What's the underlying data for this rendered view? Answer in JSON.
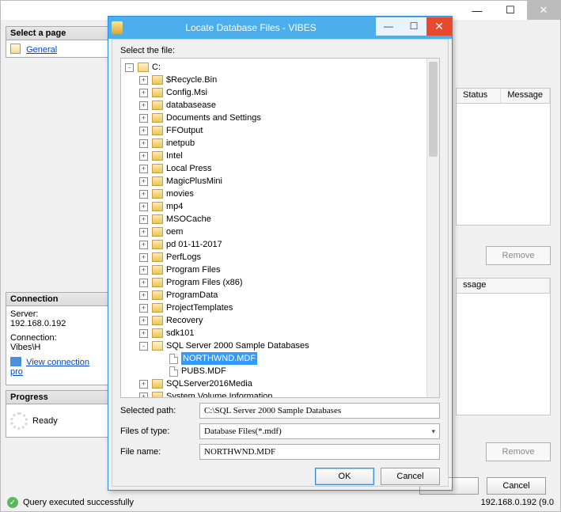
{
  "bg": {
    "select_page": "Select a page",
    "general": "General",
    "connection_h": "Connection",
    "server_lbl": "Server:",
    "server_val": "192.168.0.192",
    "conn_lbl": "Connection:",
    "conn_val": "Vibes\\H",
    "view_conn": "View connection pro",
    "progress_h": "Progress",
    "progress_state": "Ready",
    "col_status": "Status",
    "col_message": "Message",
    "col_ssage": "ssage",
    "remove": "Remove",
    "cancel": "Cancel",
    "status_msg": "Query executed successfully",
    "status_ip": "192.168.0.192 (9.0"
  },
  "modal": {
    "title": "Locate Database Files - VIBES",
    "select_file": "Select the file:",
    "root": "C:",
    "folders": [
      "$Recycle.Bin",
      "Config.Msi",
      "databasease",
      "Documents and Settings",
      "FFOutput",
      "inetpub",
      "Intel",
      "Local Press",
      "MagicPlusMini",
      "movies",
      "mp4",
      "MSOCache",
      "oem",
      "pd 01-11-2017",
      "PerfLogs",
      "Program Files",
      "Program Files (x86)",
      "ProgramData",
      "ProjectTemplates",
      "Recovery",
      "sdk101"
    ],
    "open_folder": "SQL Server 2000 Sample Databases",
    "files": [
      "NORTHWND.MDF",
      "PUBS.MDF"
    ],
    "selected_file": "NORTHWND.MDF",
    "tail_folders": [
      "SQLServer2016Media",
      "System Volume Information"
    ],
    "selpath_lbl": "Selected path:",
    "selpath_val": "C:\\SQL Server 2000 Sample Databases",
    "type_lbl": "Files of type:",
    "type_val": "Database Files(*.mdf)",
    "name_lbl": "File name:",
    "name_val": "NORTHWND.MDF",
    "ok": "OK",
    "cancel": "Cancel"
  }
}
